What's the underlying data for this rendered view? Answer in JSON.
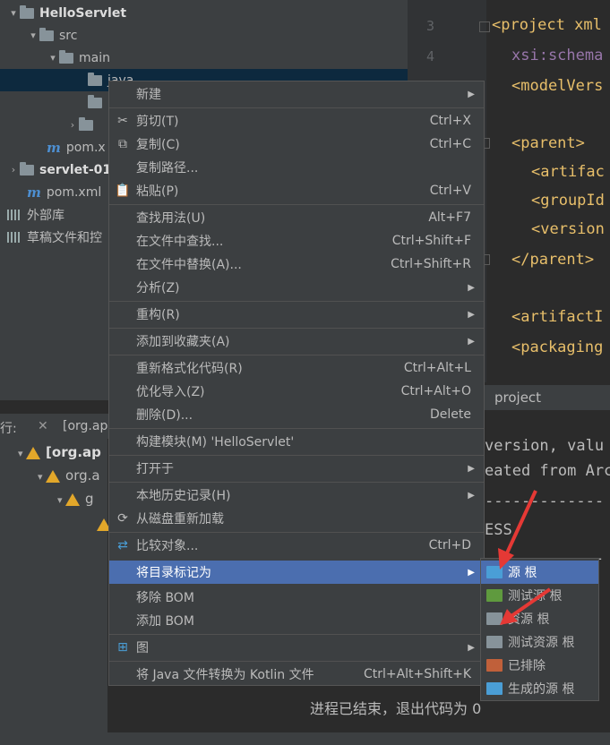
{
  "tree": {
    "root": "HelloServlet",
    "src": "src",
    "main": "main",
    "java": "java",
    "pom1": "pom.x",
    "module2": "servlet-01",
    "pom2": "pom.xml",
    "external_libs": "外部库",
    "scratches": "草稿文件和控"
  },
  "editor": {
    "line_numbers": [
      "3",
      "4",
      "5"
    ],
    "lines": [
      "<project xml",
      "xsi:schema",
      "<modelVers",
      "<parent>",
      "<artifac",
      "<groupId",
      "<version",
      "</parent>",
      "<artifactI",
      "<packaging"
    ]
  },
  "tab_project": "project",
  "run": {
    "label": "行:",
    "tab": "[org.ap",
    "tree_items": [
      "[org.ap",
      "org.a",
      "g"
    ]
  },
  "console": {
    "lines": [
      "version, valu",
      "eated from Arc",
      "-------------",
      "ESS",
      "-------------",
      "进程已结束，退出代码为 0"
    ]
  },
  "menu": {
    "items": [
      {
        "label": "新建",
        "shortcut": "",
        "icon": "",
        "arrow": true
      },
      {
        "label": "剪切(T)",
        "shortcut": "Ctrl+X",
        "icon": "scissors-icon",
        "arrow": false
      },
      {
        "label": "复制(C)",
        "shortcut": "Ctrl+C",
        "icon": "copy-icon",
        "arrow": false
      },
      {
        "label": "复制路径...",
        "shortcut": "",
        "icon": "",
        "arrow": false
      },
      {
        "label": "粘贴(P)",
        "shortcut": "Ctrl+V",
        "icon": "paste-icon",
        "arrow": false
      },
      {
        "label": "查找用法(U)",
        "shortcut": "Alt+F7",
        "icon": "",
        "arrow": false
      },
      {
        "label": "在文件中查找...",
        "shortcut": "Ctrl+Shift+F",
        "icon": "",
        "arrow": false
      },
      {
        "label": "在文件中替换(A)...",
        "shortcut": "Ctrl+Shift+R",
        "icon": "",
        "arrow": false
      },
      {
        "label": "分析(Z)",
        "shortcut": "",
        "icon": "",
        "arrow": true
      },
      {
        "label": "重构(R)",
        "shortcut": "",
        "icon": "",
        "arrow": true
      },
      {
        "label": "添加到收藏夹(A)",
        "shortcut": "",
        "icon": "",
        "arrow": true
      },
      {
        "label": "重新格式化代码(R)",
        "shortcut": "Ctrl+Alt+L",
        "icon": "",
        "arrow": false
      },
      {
        "label": "优化导入(Z)",
        "shortcut": "Ctrl+Alt+O",
        "icon": "",
        "arrow": false
      },
      {
        "label": "删除(D)...",
        "shortcut": "Delete",
        "icon": "",
        "arrow": false
      },
      {
        "label": "构建模块(M) 'HelloServlet'",
        "shortcut": "",
        "icon": "",
        "arrow": false
      },
      {
        "label": "打开于",
        "shortcut": "",
        "icon": "",
        "arrow": true
      },
      {
        "label": "本地历史记录(H)",
        "shortcut": "",
        "icon": "",
        "arrow": true
      },
      {
        "label": "从磁盘重新加载",
        "shortcut": "",
        "icon": "reload-icon",
        "arrow": false
      },
      {
        "label": "比较对象...",
        "shortcut": "Ctrl+D",
        "icon": "compare-icon",
        "arrow": false
      },
      {
        "label": "将目录标记为",
        "shortcut": "",
        "icon": "",
        "arrow": true
      },
      {
        "label": "移除 BOM",
        "shortcut": "",
        "icon": "",
        "arrow": false
      },
      {
        "label": "添加 BOM",
        "shortcut": "",
        "icon": "",
        "arrow": false
      },
      {
        "label": "图",
        "shortcut": "",
        "icon": "diagram-icon",
        "arrow": true
      },
      {
        "label": "将 Java 文件转换为 Kotlin 文件",
        "shortcut": "Ctrl+Alt+Shift+K",
        "icon": "",
        "arrow": false
      }
    ]
  },
  "submenu": {
    "items": [
      {
        "label": "源 根",
        "color": "#4a9ed6"
      },
      {
        "label": "测试源 根",
        "color": "#5f9a3e"
      },
      {
        "label": "资源 根",
        "color": "#87939a"
      },
      {
        "label": "测试资源 根",
        "color": "#87939a"
      },
      {
        "label": "已排除",
        "color": "#c0603a"
      },
      {
        "label": "生成的源 根",
        "color": "#4a9ed6"
      }
    ]
  }
}
